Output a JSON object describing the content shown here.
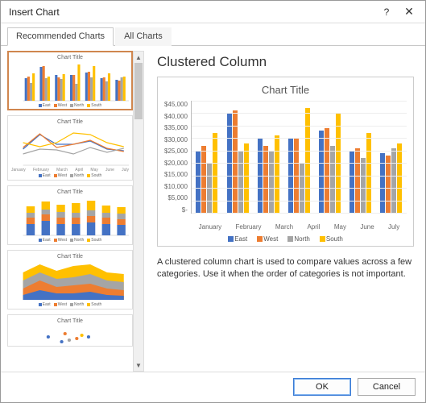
{
  "window": {
    "title": "Insert Chart"
  },
  "tabs": {
    "recommended": "Recommended Charts",
    "all": "All Charts",
    "active": "recommended"
  },
  "thumbs": {
    "title": "Chart Title",
    "categories": [
      "January",
      "February",
      "March",
      "April",
      "May",
      "June",
      "July"
    ],
    "legend": [
      "East",
      "West",
      "North",
      "South"
    ]
  },
  "main": {
    "heading": "Clustered Column",
    "description": "A clustered column chart is used to compare values across a few categories. Use it when the order of categories is not important."
  },
  "footer": {
    "ok": "OK",
    "cancel": "Cancel"
  },
  "colors": {
    "east": "#4472c4",
    "west": "#ed7d31",
    "north": "#a5a5a5",
    "south": "#ffc000"
  },
  "chart_data": {
    "type": "bar",
    "title": "Chart Title",
    "xlabel": "",
    "ylabel": "",
    "ylim": [
      0,
      45000
    ],
    "y_ticks": [
      "$45,000",
      "$40,000",
      "$35,000",
      "$30,000",
      "$25,000",
      "$20,000",
      "$15,000",
      "$10,000",
      "$5,000",
      "$-"
    ],
    "categories": [
      "January",
      "February",
      "March",
      "April",
      "May",
      "June",
      "July"
    ],
    "series": [
      {
        "name": "East",
        "values": [
          25000,
          40000,
          30000,
          30000,
          33000,
          25000,
          24000
        ]
      },
      {
        "name": "West",
        "values": [
          27000,
          41000,
          27000,
          30000,
          34000,
          26000,
          23000
        ]
      },
      {
        "name": "North",
        "values": [
          20000,
          25000,
          25000,
          20000,
          27000,
          22000,
          26000
        ]
      },
      {
        "name": "South",
        "values": [
          32000,
          28000,
          31000,
          42000,
          40000,
          32000,
          28000
        ]
      }
    ]
  }
}
